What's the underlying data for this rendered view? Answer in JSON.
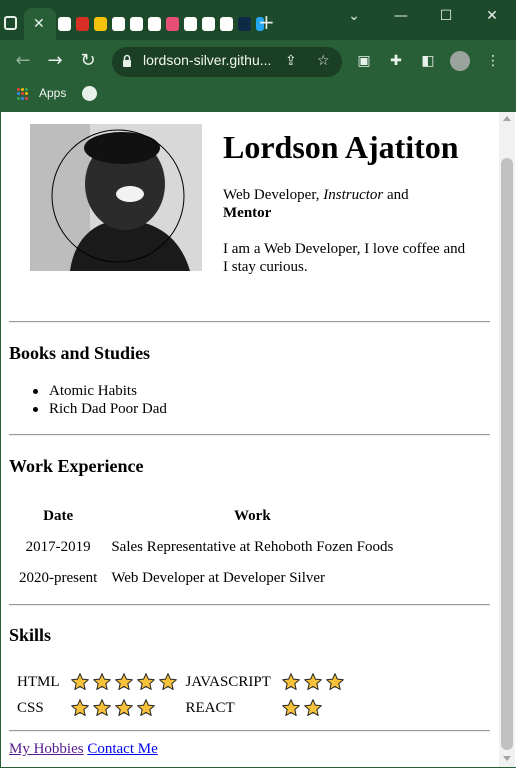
{
  "browser": {
    "url": "lordson-silver.githu...",
    "bookmarks": {
      "apps_label": "Apps"
    },
    "colors": {
      "frame": "#1d4a2b",
      "toolbar": "#285f37"
    }
  },
  "profile": {
    "name": "Lordson Ajatiton",
    "tagline": {
      "role": "Web Developer,",
      "italic": "Instructor",
      "and": "and",
      "bold": "Mentor"
    },
    "bio": "I am a Web Developer, I love coffee and I stay curious."
  },
  "books": {
    "heading": "Books and Studies",
    "items": [
      "Atomic Habits",
      "Rich Dad Poor Dad"
    ]
  },
  "work": {
    "heading": "Work Experience",
    "columns": [
      "Date",
      "Work"
    ],
    "rows": [
      {
        "date": "2017-2019",
        "work": "Sales Representative at Rehoboth Fozen Foods"
      },
      {
        "date": "2020-present",
        "work": "Web Developer at Developer Silver"
      }
    ]
  },
  "skills": {
    "heading": "Skills",
    "items": [
      {
        "name": "HTML",
        "stars": 5
      },
      {
        "name": "JAVASCRIPT",
        "stars": 3
      },
      {
        "name": "CSS",
        "stars": 4
      },
      {
        "name": "REACT",
        "stars": 2
      }
    ],
    "star_color": "#f7c23a"
  },
  "footer": {
    "links": [
      "My Hobbies",
      "Contact Me"
    ]
  }
}
